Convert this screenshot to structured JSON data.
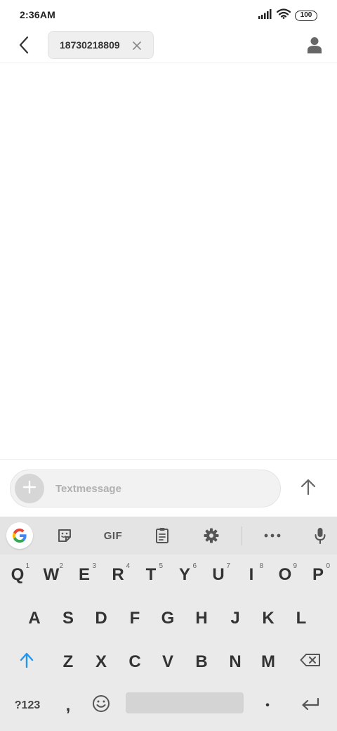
{
  "status_bar": {
    "time": "2:36AM",
    "battery": "100"
  },
  "header": {
    "recipient_chip": "18730218809",
    "icons": {
      "back": "back-arrow-icon",
      "chip_close": "close-icon",
      "contact": "person-icon"
    }
  },
  "compose": {
    "placeholder": "Textmessage",
    "value": "",
    "icons": {
      "attach": "plus-icon",
      "send": "arrow-up-icon"
    }
  },
  "keyboard": {
    "toolbar": {
      "gif_label": "GIF",
      "icons": [
        "google-icon",
        "sticker-icon",
        "clipboard-icon",
        "gear-icon",
        "more-icon",
        "mic-icon"
      ]
    },
    "row1": [
      {
        "key": "Q",
        "hint": "1"
      },
      {
        "key": "W",
        "hint": "2"
      },
      {
        "key": "E",
        "hint": "3"
      },
      {
        "key": "R",
        "hint": "4"
      },
      {
        "key": "T",
        "hint": "5"
      },
      {
        "key": "Y",
        "hint": "6"
      },
      {
        "key": "U",
        "hint": "7"
      },
      {
        "key": "I",
        "hint": "8"
      },
      {
        "key": "O",
        "hint": "9"
      },
      {
        "key": "P",
        "hint": "0"
      }
    ],
    "row2": [
      "A",
      "S",
      "D",
      "F",
      "G",
      "H",
      "J",
      "K",
      "L"
    ],
    "row3": [
      "Z",
      "X",
      "C",
      "V",
      "B",
      "N",
      "M"
    ],
    "row4": {
      "symbols_label": "?123",
      "comma": ",",
      "period": "•"
    }
  },
  "colors": {
    "accent_blue": "#2196f3",
    "keyboard_bg": "#eaeaea",
    "chip_bg": "#efefef"
  }
}
